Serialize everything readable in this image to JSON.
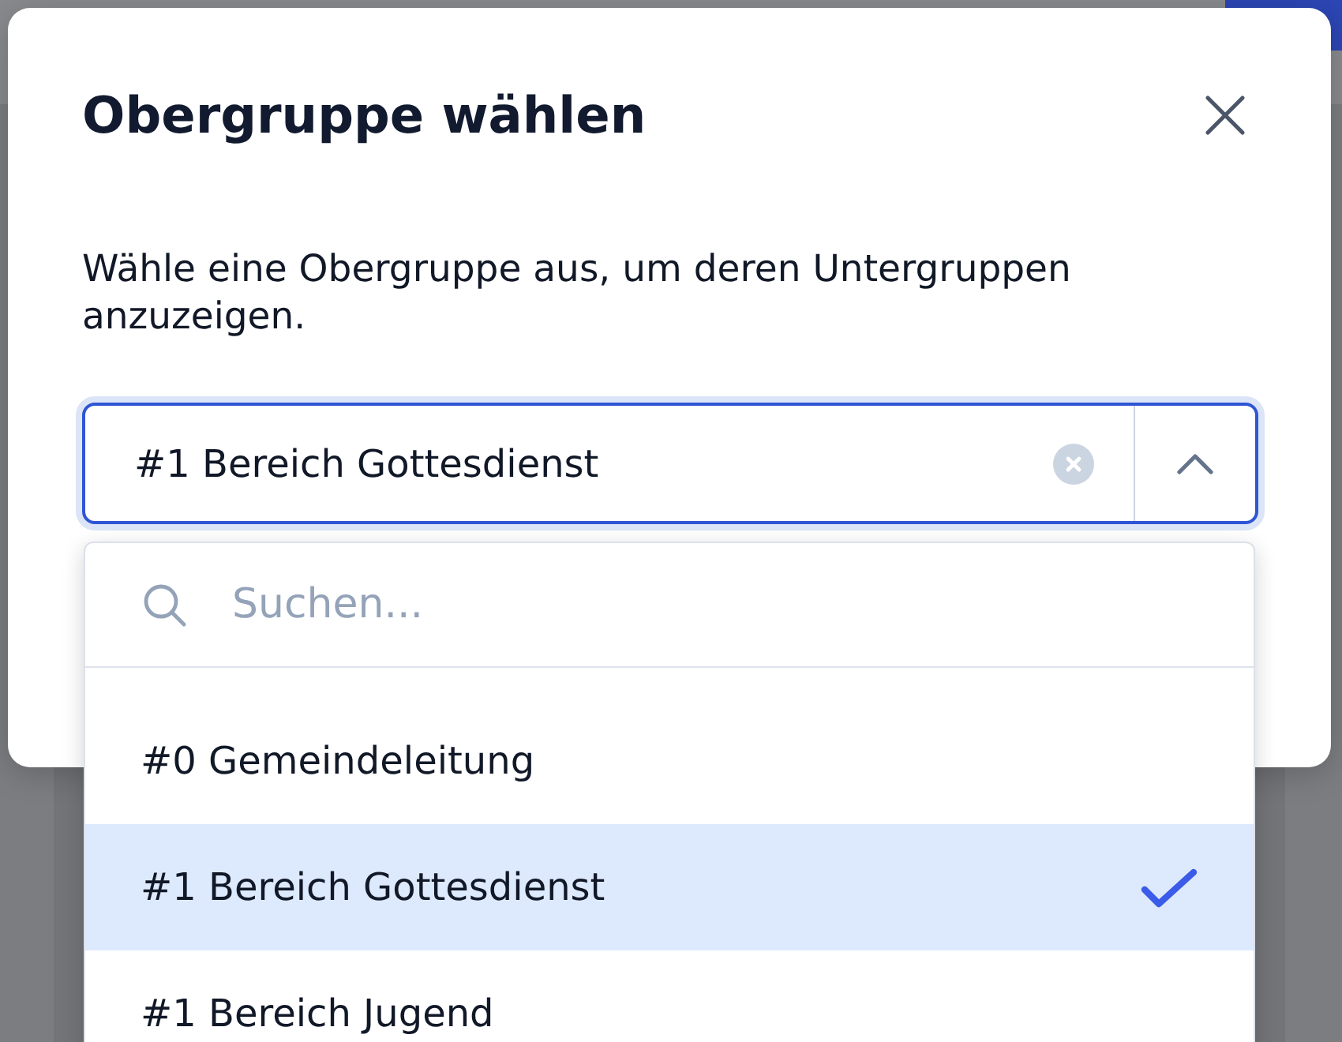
{
  "dialog": {
    "title": "Obergruppe wählen",
    "description": "Wähle eine Obergruppe aus, um deren Untergruppen anzuzeigen."
  },
  "select": {
    "value": "#1 Bereich Gottesdienst",
    "focused": true,
    "expanded": true,
    "search": {
      "placeholder": "Suchen..."
    },
    "options": [
      {
        "label": "#0 Gemeindeleitung",
        "selected": false
      },
      {
        "label": "#1 Bereich Gottesdienst",
        "selected": true
      },
      {
        "label": "#1 Bereich Jugend",
        "selected": false
      }
    ]
  }
}
